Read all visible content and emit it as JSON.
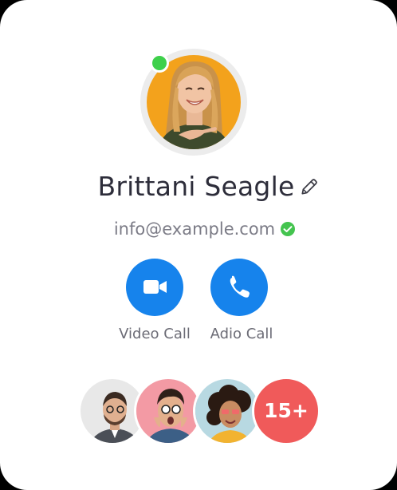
{
  "profile": {
    "name": "Brittani Seagle",
    "email": "info@example.com",
    "status": "online"
  },
  "actions": {
    "video_label": "Video Call",
    "audio_label": "Adio Call"
  },
  "friends": {
    "more_count": "15+"
  },
  "colors": {
    "accent": "#1683ec",
    "online": "#3ed04b",
    "badge": "#f05a5a"
  },
  "icons": [
    "pencil-icon",
    "verified-check-icon",
    "video-camera-icon",
    "phone-icon"
  ]
}
